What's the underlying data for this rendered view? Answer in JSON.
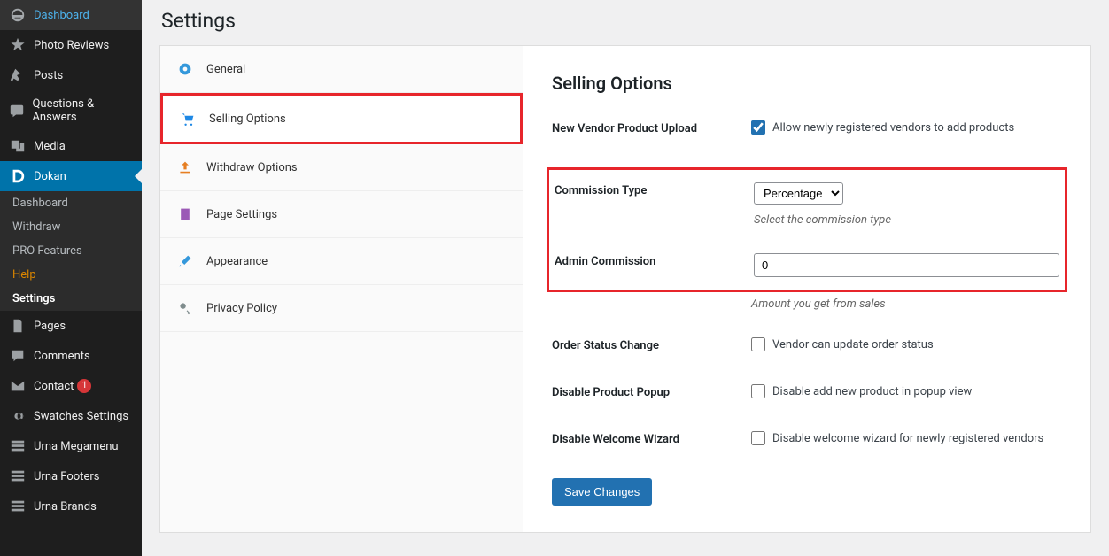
{
  "page_title": "Settings",
  "sidebar": {
    "items": [
      {
        "label": "Dashboard",
        "icon": "dashboard"
      },
      {
        "label": "Photo Reviews",
        "icon": "star"
      },
      {
        "label": "Posts",
        "icon": "pin"
      },
      {
        "label": "Questions & Answers",
        "icon": "qa"
      },
      {
        "label": "Media",
        "icon": "media"
      },
      {
        "label": "Dokan",
        "icon": "dokan"
      },
      {
        "label": "Pages",
        "icon": "pages"
      },
      {
        "label": "Comments",
        "icon": "comments"
      },
      {
        "label": "Contact",
        "icon": "mail",
        "badge": "1"
      },
      {
        "label": "Swatches Settings",
        "icon": "gear"
      },
      {
        "label": "Urna Megamenu",
        "icon": "layout"
      },
      {
        "label": "Urna Footers",
        "icon": "layout"
      },
      {
        "label": "Urna Brands",
        "icon": "layout"
      }
    ],
    "submenu": [
      {
        "label": "Dashboard"
      },
      {
        "label": "Withdraw"
      },
      {
        "label": "PRO Features"
      },
      {
        "label": "Help"
      },
      {
        "label": "Settings"
      }
    ]
  },
  "tabs": [
    {
      "label": "General",
      "color": "#3498db"
    },
    {
      "label": "Selling Options",
      "color": "#1abc9c"
    },
    {
      "label": "Withdraw Options",
      "color": "#e67e22"
    },
    {
      "label": "Page Settings",
      "color": "#9b59b6"
    },
    {
      "label": "Appearance",
      "color": "#3498db"
    },
    {
      "label": "Privacy Policy",
      "color": "#7f8c8d"
    }
  ],
  "content": {
    "heading": "Selling Options",
    "fields": {
      "new_vendor_upload": {
        "label": "New Vendor Product Upload",
        "check_label": "Allow newly registered vendors to add products",
        "checked": true
      },
      "commission_type": {
        "label": "Commission Type",
        "value": "Percentage",
        "desc": "Select the commission type"
      },
      "admin_commission": {
        "label": "Admin Commission",
        "value": "0",
        "desc": "Amount you get from sales"
      },
      "order_status": {
        "label": "Order Status Change",
        "check_label": "Vendor can update order status",
        "checked": false
      },
      "disable_popup": {
        "label": "Disable Product Popup",
        "check_label": "Disable add new product in popup view",
        "checked": false
      },
      "disable_wizard": {
        "label": "Disable Welcome Wizard",
        "check_label": "Disable welcome wizard for newly registered vendors",
        "checked": false
      }
    },
    "save_button": "Save Changes"
  }
}
